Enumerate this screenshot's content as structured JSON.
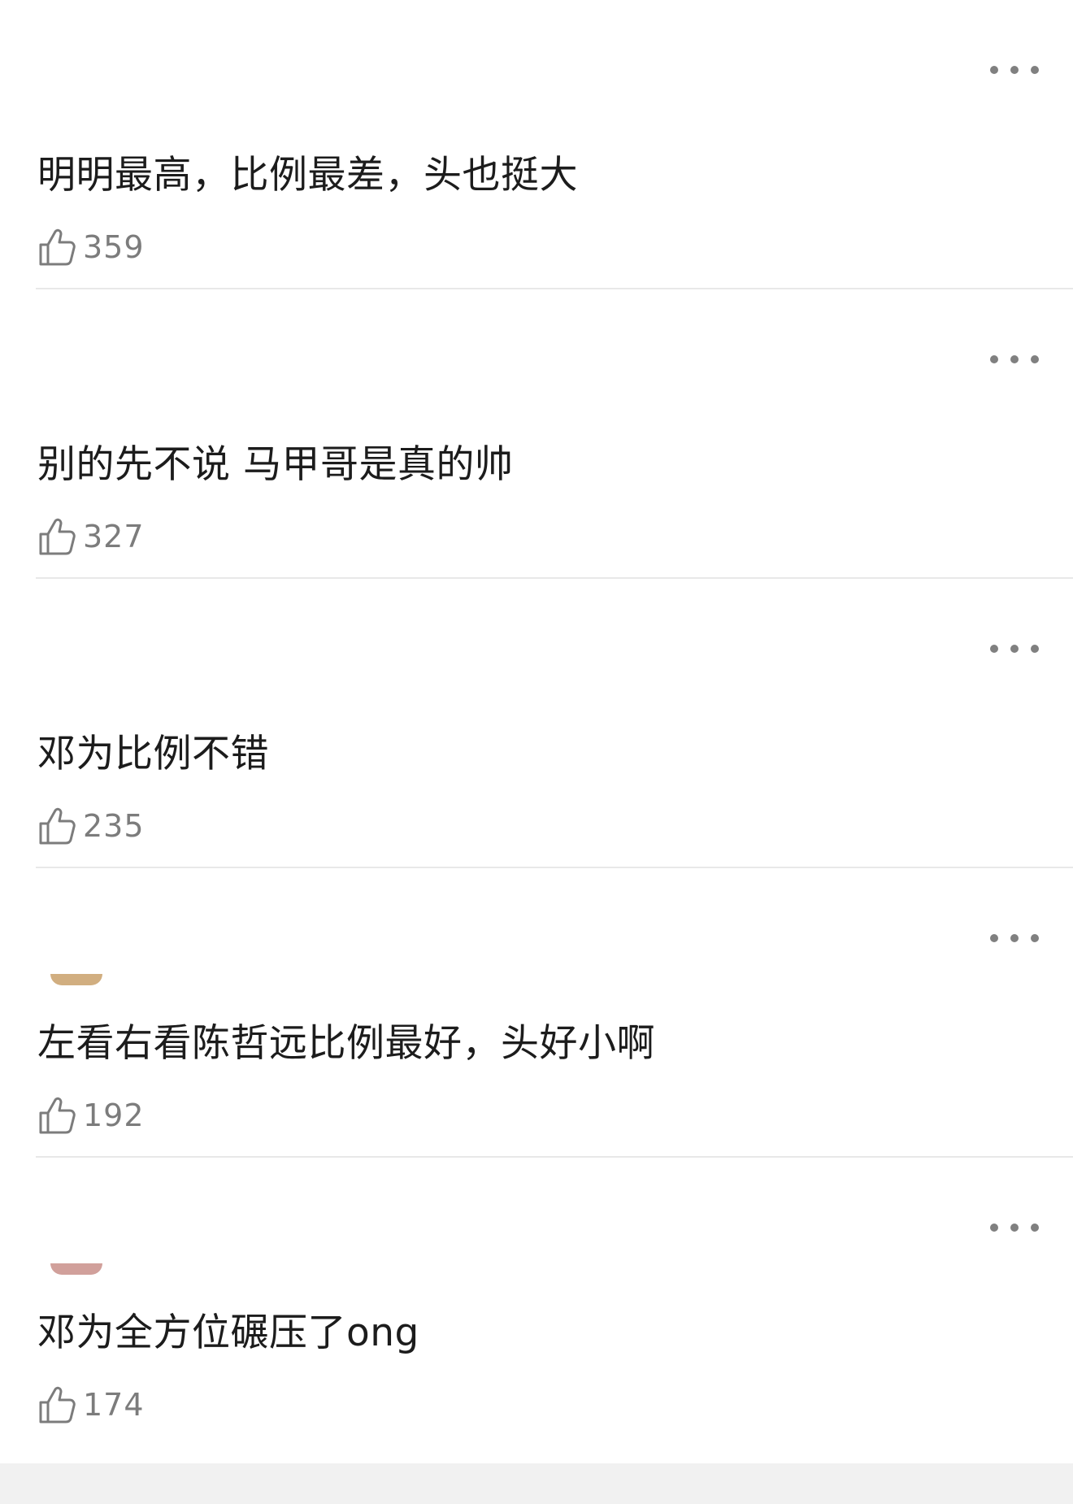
{
  "comments": [
    {
      "text": "明明最高，比例最差，头也挺大",
      "likes": "359"
    },
    {
      "text": "别的先不说 马甲哥是真的帅",
      "likes": "327"
    },
    {
      "text": "邓为比例不错",
      "likes": "235"
    },
    {
      "text": "左看右看陈哲远比例最好，头好小啊",
      "likes": "192"
    },
    {
      "text": "邓为全方位碾压了ong",
      "likes": "174"
    }
  ],
  "icons": {
    "more": "more-dots-icon",
    "like": "thumbs-up-icon"
  },
  "colors": {
    "background": "#ffffff",
    "text": "#1c1c1c",
    "muted": "#7c7c7c",
    "divider": "#e8e8e8",
    "footer": "#f1f1f1"
  }
}
